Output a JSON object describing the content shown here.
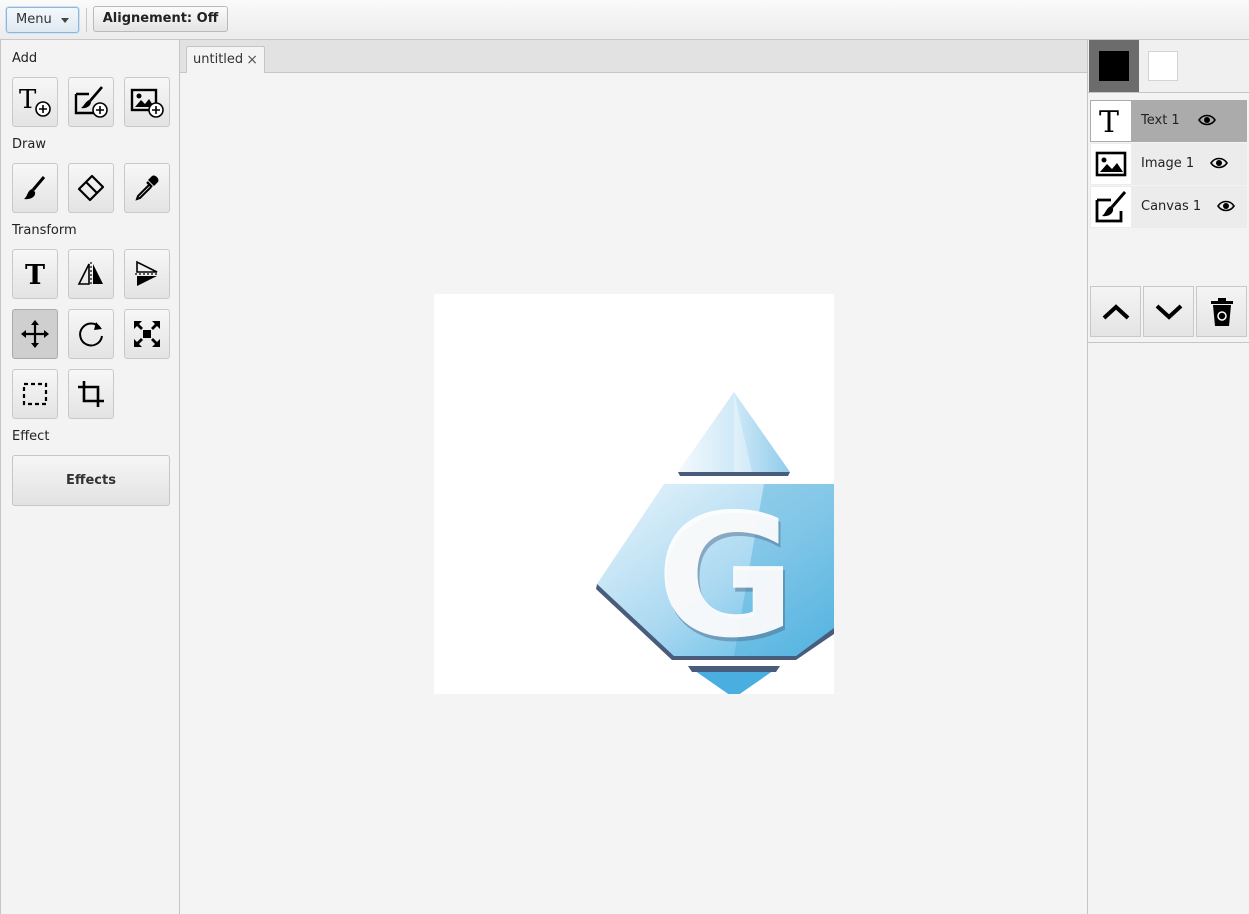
{
  "toolbar": {
    "menu_label": "Menu",
    "alignment_label": "Alignement: Off"
  },
  "tools": {
    "sections": {
      "add": "Add",
      "draw": "Draw",
      "transform": "Transform",
      "effect": "Effect"
    },
    "add_items": [
      "add-text-icon",
      "add-canvas-icon",
      "add-image-icon"
    ],
    "draw_items": [
      "brush-icon",
      "eraser-icon",
      "eyedropper-icon"
    ],
    "transform_items": [
      "text-icon",
      "flip-horizontal-icon",
      "flip-vertical-icon",
      "move-icon",
      "rotate-icon",
      "scale-icon",
      "select-icon",
      "crop-icon"
    ],
    "active_tool": "move-icon",
    "effects_label": "Effects"
  },
  "document": {
    "tab_title": "untitled",
    "tab_close": "×",
    "canvas_background": "#ffffff",
    "logo_letter": "G"
  },
  "colors": {
    "foreground": "#000000",
    "background": "#ffffff"
  },
  "layers": [
    {
      "name": "Text 1",
      "type": "text",
      "visible": true,
      "selected": true
    },
    {
      "name": "Image 1",
      "type": "image",
      "visible": true,
      "selected": false
    },
    {
      "name": "Canvas 1",
      "type": "canvas",
      "visible": true,
      "selected": false
    }
  ],
  "layer_actions": [
    "move-up-icon",
    "move-down-icon",
    "delete-icon"
  ]
}
